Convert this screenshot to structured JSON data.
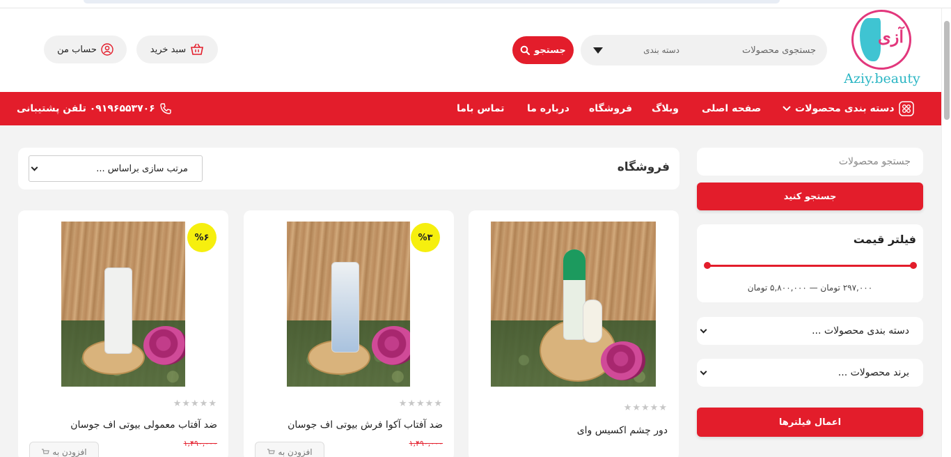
{
  "header": {
    "logo_script": "آزی",
    "logo_text": "Aziy.beauty",
    "search_placeholder": "جستجوی محصولات",
    "category_label": "دسته بندی",
    "search_button": "جستجو",
    "cart_label": "سبد خرید",
    "account_label": "حساب من"
  },
  "nav": {
    "categories": "دسته بندی محصولات",
    "home": "صفحه اصلی",
    "blog": "وبلاگ",
    "shop": "فروشگاه",
    "about": "درباره ما",
    "contact": "تماس باما",
    "support": "۰۹۱۹۶۵۵۳۷۰۶ تلفن پشتیبانی"
  },
  "sidebar": {
    "search_placeholder": "جستجو محصولات",
    "search_button": "جستجو کنید",
    "price_filter_title": "فیلتر قیمت",
    "price_range": "۲۹۷,۰۰۰ تومان — ۵,۸۰۰,۰۰۰ تومان",
    "price_min_fraction": 0,
    "price_max_fraction": 1,
    "category_dropdown": "دسته بندی محصولات ...",
    "brand_dropdown": "برند محصولات ...",
    "apply_button": "اعمال فیلترها"
  },
  "shop": {
    "title": "فروشگاه",
    "sort_label": "مرتب سازی براساس ..."
  },
  "products": [
    {
      "name": "دور چشم اکسیس وای",
      "rating_stars": "★★★★★",
      "badge": "",
      "old_price": ""
    },
    {
      "name": "ضد آفتاب آکوا فرش بیوتی اف جوسان",
      "rating_stars": "★★★★★",
      "badge": "%۳",
      "old_price": "۱,۴۹۰,۰۰۰",
      "add_label": "افزودن به"
    },
    {
      "name": "ضد آفتاب معمولی بیوتی اف جوسان",
      "rating_stars": "★★★★★",
      "badge": "%۶",
      "old_price": "۱,۴۹۰,۰۰۰",
      "add_label": "افزودن به"
    }
  ],
  "colors": {
    "brand_red": "#e31d2b",
    "badge_yellow": "#f6ef0e",
    "logo_pink": "#e2377c",
    "logo_teal": "#2bb6c4"
  }
}
